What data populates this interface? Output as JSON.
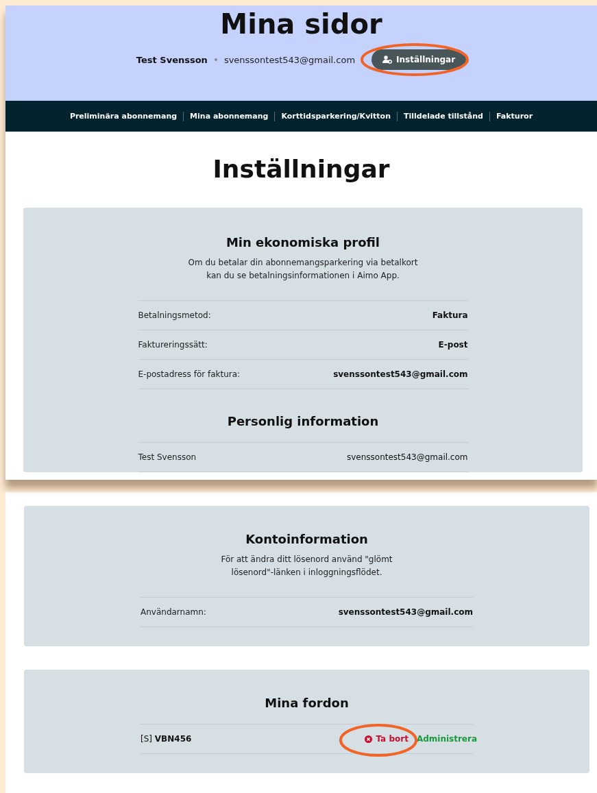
{
  "header": {
    "title": "Mina sidor",
    "user_name": "Test Svensson",
    "user_email": "svenssontest543@gmail.com",
    "settings_button": {
      "label": "Inställningar",
      "circled": true
    }
  },
  "nav": {
    "items": [
      {
        "label": "Preliminära abonnemang"
      },
      {
        "label": "Mina abonnemang"
      },
      {
        "label": "Korttidsparkering/Kvitton"
      },
      {
        "label": "Tilldelade tillstånd"
      },
      {
        "label": "Fakturor"
      }
    ]
  },
  "page_title": "Inställningar",
  "profile_card": {
    "sections": [
      {
        "title": "Min ekonomiska profil",
        "description": [
          "Om du betalar din abonnemangsparkering via betalkort",
          "kan du se betalningsinformationen i Aimo App."
        ],
        "rows": [
          {
            "label": "Betalningsmetod:",
            "value": "Faktura",
            "emphasis": true
          },
          {
            "label": "Faktureringssätt:",
            "value": "E-post",
            "emphasis": true
          },
          {
            "label": "E-postadress för faktura:",
            "value": "svenssontest543@gmail.com",
            "emphasis": true
          }
        ]
      },
      {
        "title": "Personlig information",
        "rows": [
          {
            "label": "Test Svensson",
            "value": "svenssontest543@gmail.com",
            "emphasis": false
          }
        ]
      }
    ]
  },
  "account_card": {
    "title": "Kontoinformation",
    "description": [
      "För att ändra ditt lösenord använd \"glömt",
      "lösenord\"-länken i inloggningsflödet."
    ],
    "rows": [
      {
        "label": "Användarnamn:",
        "value": "svenssontest543@gmail.com",
        "emphasis": true
      }
    ]
  },
  "vehicles_card": {
    "title": "Mina fordon",
    "vehicles": [
      {
        "prefix": "[S]",
        "plate": "VBN456",
        "remove_label": "Ta bort",
        "remove_circled": true,
        "manage_label": "Administrera"
      }
    ]
  }
}
